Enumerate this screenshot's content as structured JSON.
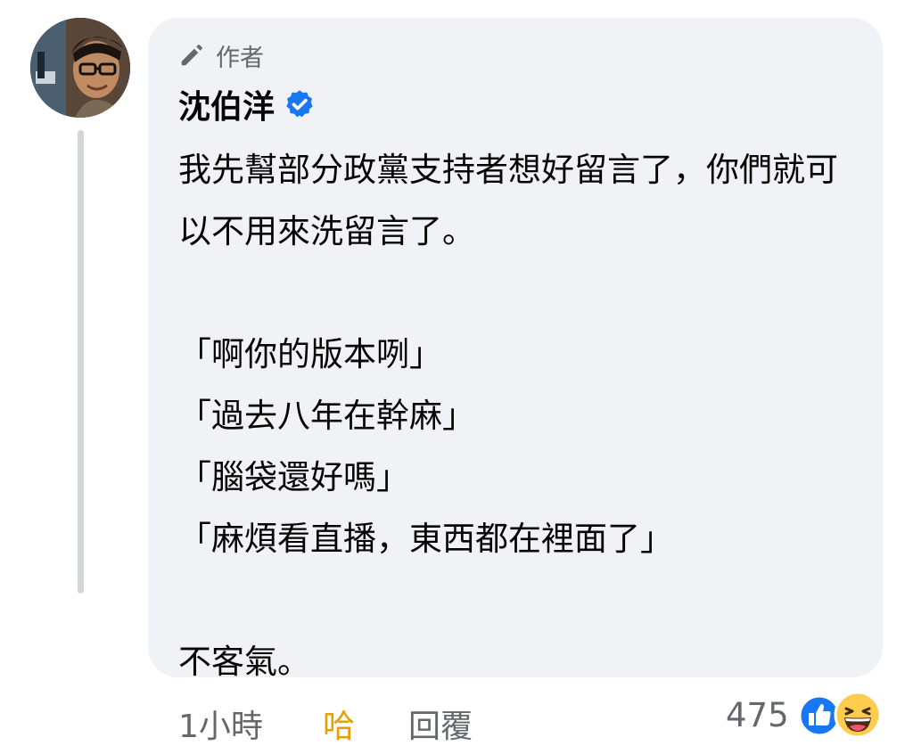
{
  "comment": {
    "author_badge": "作者",
    "author_name": "沈伯洋",
    "body": "我先幫部分政黨支持者想好留言了，你們就可以不用來洗留言了。\n\n「啊你的版本咧」\n「過去八年在幹麻」\n「腦袋還好嗎」\n「麻煩看直播，東西都在裡面了」\n\n不客氣。",
    "verified": true
  },
  "actions": {
    "time": "1小時",
    "reaction_label": "哈",
    "reply_label": "回覆"
  },
  "reactions": {
    "count": "475",
    "icons": [
      "like-icon",
      "haha-icon"
    ]
  },
  "colors": {
    "bubble": "#f0f2f5",
    "verified_blue": "#1877f2",
    "haha_yellow": "#e3a000",
    "secondary_text": "#65676b"
  }
}
